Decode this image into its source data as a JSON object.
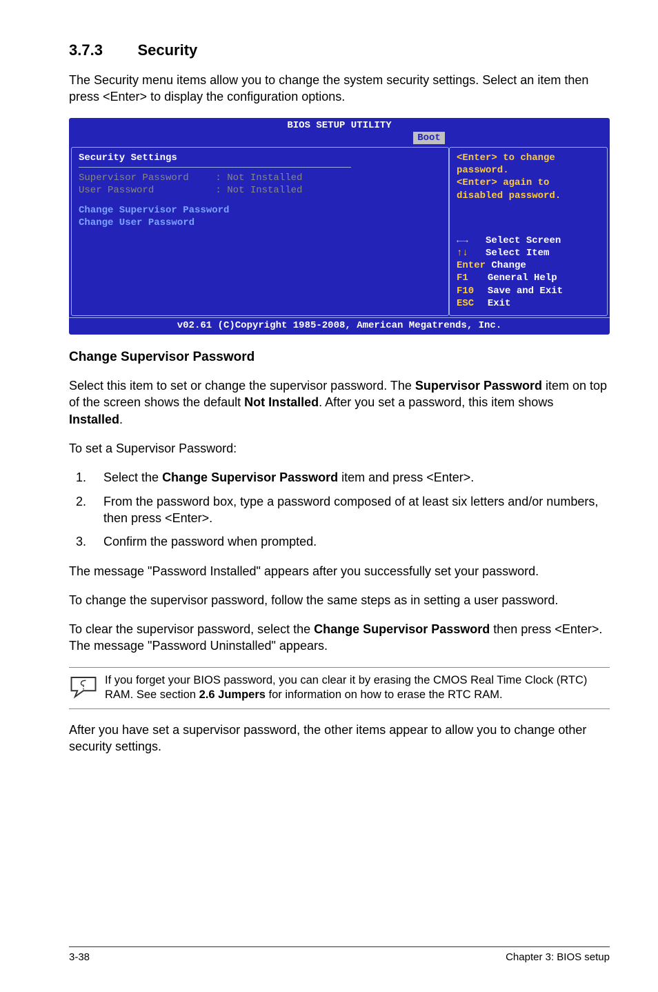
{
  "section": {
    "num": "3.7.3",
    "title": "Security"
  },
  "intro": "The Security menu items allow you to change the system security settings. Select an item then press <Enter> to display the configuration options.",
  "bios": {
    "title": "BIOS SETUP UTILITY",
    "tab": "Boot",
    "left": {
      "heading": "Security Settings",
      "row1_label": "Supervisor Password",
      "row1_val": ": Not Installed",
      "row2_label": "User Password",
      "row2_val": ": Not Installed",
      "action1": "Change Supervisor Password",
      "action2": "Change User Password"
    },
    "right_top": "<Enter> to change password.\n<Enter> again to disabled password.",
    "help": {
      "select_screen": "Select Screen",
      "select_item": "Select Item",
      "enter_key": "Enter",
      "enter_label": "Change",
      "f1_key": "F1",
      "f1_label": "General Help",
      "f10_key": "F10",
      "f10_label": "Save and Exit",
      "esc_key": "ESC",
      "esc_label": "Exit"
    },
    "footer": "v02.61 (C)Copyright 1985-2008, American Megatrends, Inc."
  },
  "subhead": "Change Supervisor Password",
  "p2_a": "Select this item to set or change the supervisor password. The ",
  "p2_b": "Supervisor Password",
  "p2_c": " item on top of the screen shows the default ",
  "p2_d": "Not Installed",
  "p2_e": ". After you set a password, this item shows ",
  "p2_f": "Installed",
  "p2_g": ".",
  "p3": "To set a Supervisor Password:",
  "steps": {
    "s1a": "Select the ",
    "s1b": "Change Supervisor Password",
    "s1c": " item and press <Enter>.",
    "s2": "From the password box, type a password composed of at least six letters and/or numbers, then press <Enter>.",
    "s3": "Confirm the password when prompted."
  },
  "p4": "The message \"Password Installed\" appears after you successfully set your password.",
  "p5": "To change the supervisor password, follow the same steps as in setting a user password.",
  "p6a": "To clear the supervisor password, select the ",
  "p6b": "Change Supervisor Password",
  "p6c": " then press <Enter>. The message \"Password Uninstalled\" appears.",
  "note_a": "If you forget your BIOS password, you can clear it by erasing the CMOS Real Time Clock (RTC) RAM. See section ",
  "note_b": "2.6 Jumpers",
  "note_c": " for information on how to erase the RTC RAM.",
  "p7": "After you have set a supervisor password, the other items appear to allow you to change other security settings.",
  "footer": {
    "left": "3-38",
    "right": "Chapter 3: BIOS setup"
  }
}
